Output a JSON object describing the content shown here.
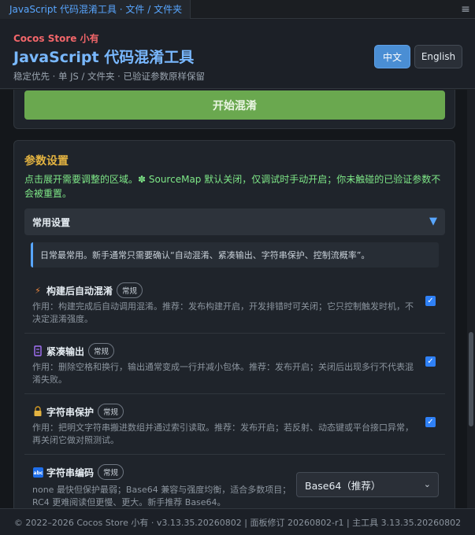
{
  "titlebar": {
    "tab_title": "JavaScript 代码混淆工具 · 文件 / 文件夹",
    "menu_icon": "≡"
  },
  "header": {
    "brand": "Cocos Store 小有",
    "title": "JavaScript 代码混淆工具",
    "subtitle": "稳定优先 · 单 JS / 文件夹 · 已验证参数原样保留",
    "lang_zh": "中文",
    "lang_en": "English"
  },
  "start_button": "开始混淆",
  "params": {
    "title": "参数设置",
    "desc": "点击展开需要调整的区域。✽ SourceMap 默认关闭，仅调试时手动开启；你未触碰的已验证参数不会被重置。",
    "section_title": "常用设置",
    "section_arrow": "▼",
    "note": "日常最常用。新手通常只需要确认“自动混淆、紧凑输出、字符串保护、控制流概率”。"
  },
  "items": [
    {
      "name": "构建后自动混淆",
      "badge": "常规",
      "desc": "作用：构建完成后自动调用混淆。推荐：发布构建开启，开发排错时可关闭；它只控制触发时机，不决定混淆强度。",
      "checked": true
    },
    {
      "name": "紧凑输出",
      "badge": "常规",
      "desc": "作用：删除空格和换行，输出通常变成一行并减小包体。推荐：发布开启；关闭后出现多行不代表混淆失败。",
      "checked": true
    },
    {
      "name": "字符串保护",
      "badge": "常规",
      "desc": "作用：把明文字符串搬进数组并通过索引读取。推荐：发布开启；若反射、动态键或平台接口异常，再关闭它做对照测试。",
      "checked": true
    },
    {
      "name": "字符串编码",
      "badge": "常规",
      "desc": "none 最快但保护最弱；Base64 兼容与强度均衡，适合多数项目；RC4 更难阅读但更慢、更大。新手推荐 Base64。",
      "select_value": "Base64（推荐）"
    }
  ],
  "footer": "© 2022–2026 Cocos Store 小有 · v3.13.35.20260802 | 面板修订 20260802-r1 | 主工具 3.13.35.20260802"
}
